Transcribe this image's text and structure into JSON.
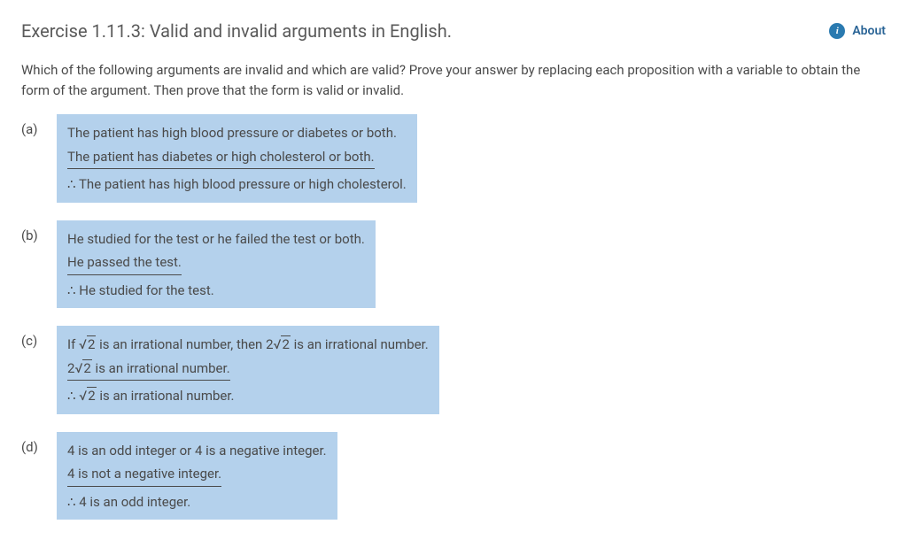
{
  "header": {
    "title": "Exercise 1.11.3: Valid and invalid arguments in English.",
    "about_label": "About"
  },
  "instructions": "Which of the following arguments are invalid and which are valid? Prove your answer by replacing each proposition with a variable to obtain the form of the argument. Then prove that the form is valid or invalid.",
  "therefore_symbol": "∴",
  "items": {
    "a": {
      "label": "(a)",
      "premise1": "The patient has high blood pressure or diabetes or both.",
      "premise2": "The patient has diabetes or high cholesterol or both.",
      "conclusion": "The patient has high blood pressure or high cholesterol."
    },
    "b": {
      "label": "(b)",
      "premise1": "He studied for the test or he failed the test or both.",
      "premise2": "He passed the test.",
      "conclusion": "He studied for the test."
    },
    "c": {
      "label": "(c)",
      "premise1_pre": "If ",
      "premise1_mid": " is an irrational number, then ",
      "premise1_post": " is an irrational number.",
      "premise2_post": " is an irrational number.",
      "conclusion_post": " is an irrational number.",
      "sqrt2": "2",
      "coef2": "2",
      "sqrt_sym": "√"
    },
    "d": {
      "label": "(d)",
      "premise1": "4 is an odd integer or 4 is a negative integer.",
      "premise2": "4 is not a negative integer.",
      "conclusion": "4 is an odd integer."
    }
  }
}
